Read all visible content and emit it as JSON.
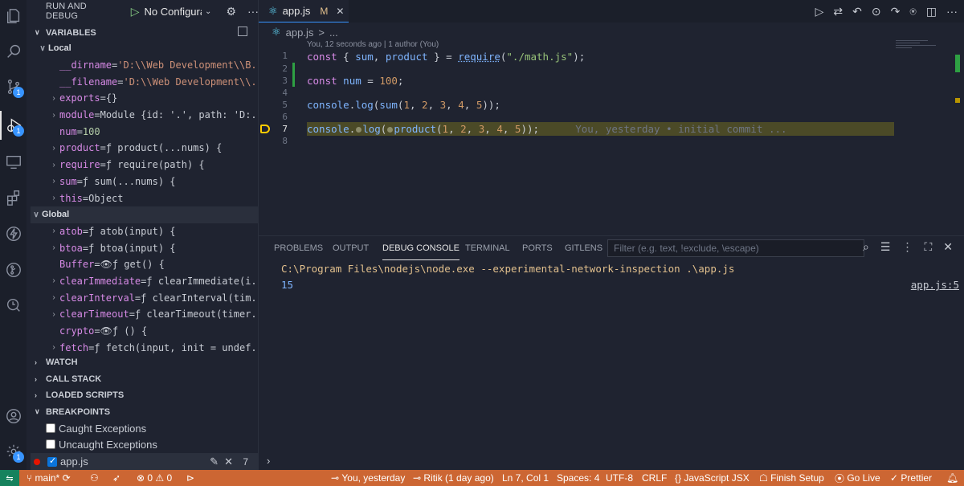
{
  "sidebar": {
    "title": "RUN AND DEBUG",
    "config": "No Configurati",
    "variables_header": "VARIABLES",
    "local_label": "Local",
    "global_label": "Global",
    "watch": "WATCH",
    "call_stack": "CALL STACK",
    "loaded_scripts": "LOADED SCRIPTS",
    "breakpoints": "BREAKPOINTS",
    "caught": "Caught Exceptions",
    "uncaught": "Uncaught Exceptions",
    "bp_file": "app.js",
    "bp_count": "7"
  },
  "local_vars": [
    {
      "name": "__dirname",
      "value": "'D:\\\\Web Development\\\\B..."
    },
    {
      "name": "__filename",
      "value": "'D:\\\\Web Development\\\\..."
    },
    {
      "name": "exports",
      "value": "{}"
    },
    {
      "name": "module",
      "value": "Module {id: '.', path: 'D:..."
    },
    {
      "name": "num",
      "value": "100"
    },
    {
      "name": "product",
      "value": "ƒ product(...nums) {"
    },
    {
      "name": "require",
      "value": "ƒ require(path) {"
    },
    {
      "name": "sum",
      "value": "ƒ sum(...nums) {"
    },
    {
      "name": "this",
      "value": "Object"
    }
  ],
  "global_vars": [
    {
      "name": "atob",
      "value": "ƒ atob(input) {"
    },
    {
      "name": "btoa",
      "value": "ƒ btoa(input) {"
    },
    {
      "name": "Buffer",
      "value": "ƒ get() {"
    },
    {
      "name": "clearImmediate",
      "value": "ƒ clearImmediate(i..."
    },
    {
      "name": "clearInterval",
      "value": "ƒ clearInterval(tim..."
    },
    {
      "name": "clearTimeout",
      "value": "ƒ clearTimeout(timer..."
    },
    {
      "name": "crypto",
      "value": "ƒ () {"
    },
    {
      "name": "fetch",
      "value": "ƒ fetch(input, init = undef..."
    }
  ],
  "editor": {
    "tab_name": "app.js",
    "tab_status": "M",
    "breadcrumb_file": "app.js",
    "breadcrumb_sep": ">",
    "breadcrumb_more": "...",
    "codelens": "You, 12 seconds ago | 1 author (You)",
    "line_numbers": [
      "1",
      "2",
      "3",
      "4",
      "5",
      "6",
      "7",
      "8"
    ],
    "blame": "You, yesterday • initial commit ..."
  },
  "panel": {
    "tabs": [
      "PROBLEMS",
      "OUTPUT",
      "DEBUG CONSOLE",
      "TERMINAL",
      "PORTS",
      "GITLENS"
    ],
    "filter_placeholder": "Filter (e.g. text, !exclude, \\escape)",
    "command": "C:\\Program Files\\nodejs\\node.exe --experimental-network-inspection .\\app.js",
    "output": "15",
    "source": "app.js:5"
  },
  "status": {
    "branch": "main*",
    "errors": "0",
    "warnings": "0",
    "blame": "You, yesterday",
    "author": "Ritik (1 day ago)",
    "position": "Ln 7, Col 1",
    "spaces": "Spaces: 4",
    "encoding": "UTF-8",
    "eol": "CRLF",
    "language": "JavaScript JSX",
    "finish_setup": "Finish Setup",
    "go_live": "Go Live",
    "prettier": "Prettier"
  },
  "colors": {
    "status_bar": "#cc6633",
    "accent": "#3794ff",
    "current_line": "#4b4a27"
  }
}
